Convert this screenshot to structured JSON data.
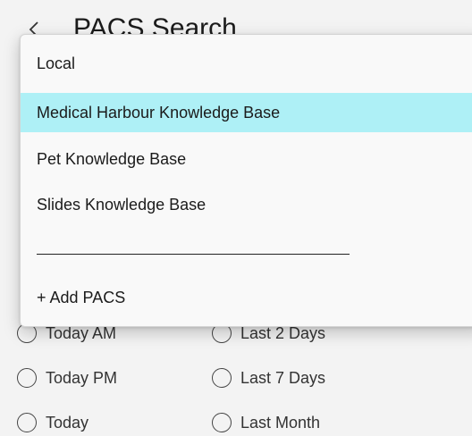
{
  "header": {
    "title": "PACS Search",
    "back_icon": "arrow-left-icon"
  },
  "dropdown": {
    "items": [
      {
        "label": "Local",
        "selected": false
      },
      {
        "label": "Medical Harbour Knowledge Base",
        "selected": true
      },
      {
        "label": "Pet Knowledge Base",
        "selected": false
      },
      {
        "label": "Slides Knowledge Base",
        "selected": false
      }
    ],
    "add_label": "+ Add PACS",
    "selected_color": "#aef0f6"
  },
  "date_filters": {
    "left": [
      "Today AM",
      "Today PM",
      "Today"
    ],
    "right": [
      "Last 2 Days",
      "Last 7 Days",
      "Last Month"
    ]
  }
}
